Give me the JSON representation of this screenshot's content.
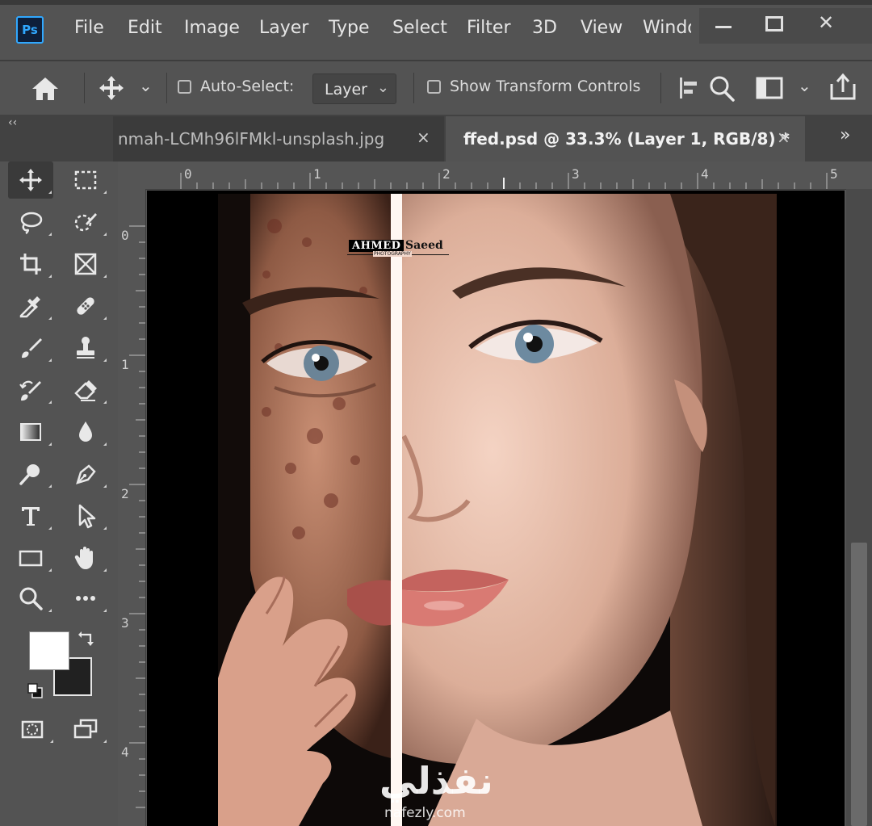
{
  "app": {
    "logo_text": "Ps"
  },
  "menu": [
    "File",
    "Edit",
    "Image",
    "Layer",
    "Type",
    "Select",
    "Filter",
    "3D",
    "View",
    "Windo"
  ],
  "window_controls": {
    "close": "✕"
  },
  "options_bar": {
    "move_tool_chevron": "⌄",
    "auto_select_label": "Auto-Select:",
    "auto_select_checked": false,
    "auto_select_target": "Layer",
    "select_chevron": "⌄",
    "show_transform_label": "Show Transform Controls",
    "show_transform_checked": false,
    "panel_chevron": "⌄"
  },
  "tabs": [
    {
      "title": "nmah-LCMh96lFMkl-unsplash.jpg",
      "close": "×",
      "active": false
    },
    {
      "title": "ffed.psd @ 33.3% (Layer 1, RGB/8) *",
      "close": "×",
      "active": true
    }
  ],
  "tabs_overflow": "»",
  "collapse_arrows": "‹‹",
  "rulers": {
    "horizontal": [
      "0",
      "1",
      "2",
      "3",
      "4",
      "5"
    ],
    "vertical": [
      "0",
      "1",
      "2",
      "3",
      "4"
    ]
  },
  "tools": [
    {
      "name": "move-tool-icon",
      "active": true
    },
    {
      "name": "rectangular-marquee-tool-icon"
    },
    {
      "name": "lasso-tool-icon"
    },
    {
      "name": "quick-selection-tool-icon"
    },
    {
      "name": "crop-tool-icon"
    },
    {
      "name": "frame-tool-icon"
    },
    {
      "name": "eyedropper-tool-icon"
    },
    {
      "name": "spot-healing-brush-tool-icon"
    },
    {
      "name": "brush-tool-icon"
    },
    {
      "name": "clone-stamp-tool-icon"
    },
    {
      "name": "history-brush-tool-icon"
    },
    {
      "name": "eraser-tool-icon"
    },
    {
      "name": "gradient-tool-icon"
    },
    {
      "name": "blur-tool-icon"
    },
    {
      "name": "dodge-tool-icon"
    },
    {
      "name": "pen-tool-icon"
    },
    {
      "name": "type-tool-icon"
    },
    {
      "name": "path-selection-tool-icon"
    },
    {
      "name": "rectangle-tool-icon"
    },
    {
      "name": "hand-tool-icon"
    },
    {
      "name": "zoom-tool-icon"
    },
    {
      "name": "edit-toolbar-icon"
    }
  ],
  "swatches": {
    "foreground": "#ffffff",
    "background": "#212121"
  },
  "colors": {
    "accent": "#30a8ff",
    "ui_bg": "#535353",
    "tab_bar": "#424242"
  },
  "canvas": {
    "signature_strong": "AHMED",
    "signature_rest": "Saeed",
    "signature_sub": "PHOTOGRAPHY",
    "brand_arabic": "نفذلي",
    "brand_url": "nafezly.com"
  }
}
